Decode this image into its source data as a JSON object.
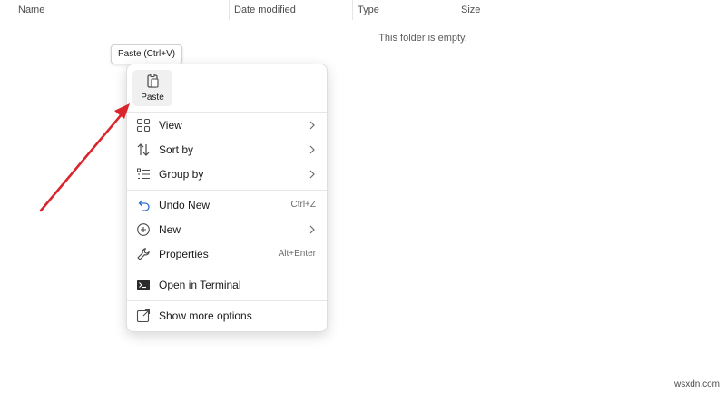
{
  "columns": [
    {
      "label": "Name"
    },
    {
      "label": "Date modified"
    },
    {
      "label": "Type"
    },
    {
      "label": "Size"
    }
  ],
  "empty_message": "This folder is empty.",
  "tooltip": "Paste (Ctrl+V)",
  "quick_actions": {
    "paste_label": "Paste",
    "paste_icon": "paste-icon"
  },
  "menu": {
    "view": {
      "label": "View",
      "icon": "grid-icon"
    },
    "sort_by": {
      "label": "Sort by",
      "icon": "sort-arrows-icon"
    },
    "group_by": {
      "label": "Group by",
      "icon": "list-icon"
    },
    "undo_new": {
      "label": "Undo New",
      "shortcut": "Ctrl+Z",
      "icon": "undo-icon"
    },
    "new": {
      "label": "New",
      "icon": "plus-circle-icon"
    },
    "properties": {
      "label": "Properties",
      "shortcut": "Alt+Enter",
      "icon": "wrench-icon"
    },
    "open_terminal": {
      "label": "Open in Terminal",
      "icon": "terminal-icon"
    },
    "show_more": {
      "label": "Show more options",
      "icon": "expand-icon"
    }
  },
  "watermark": "wsxdn.com",
  "colors": {
    "arrow": "#d9262c",
    "menu_hover": "#f0f0f0",
    "icon": "#4a4a4a"
  }
}
